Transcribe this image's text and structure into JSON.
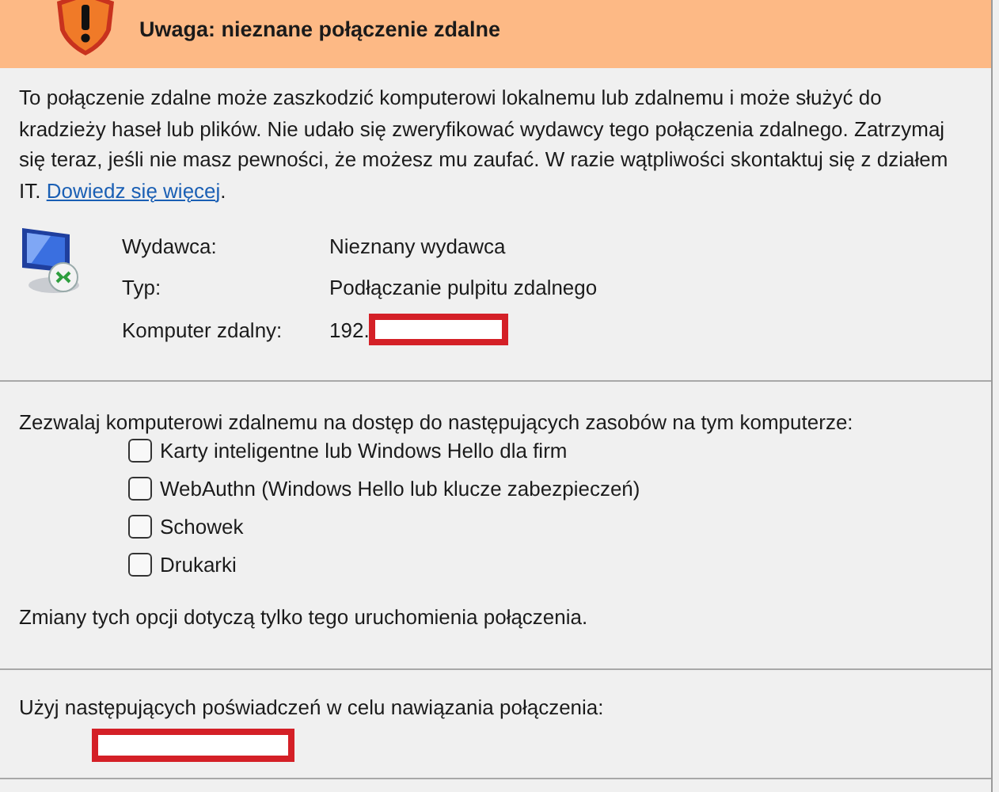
{
  "header": {
    "title": "Uwaga: nieznane połączenie zdalne"
  },
  "description": {
    "text": "To połączenie zdalne może zaszkodzić komputerowi lokalnemu lub zdalnemu i może służyć do kradzieży haseł lub plików. Nie udało się zweryfikować wydawcy tego połączenia zdalnego. Zatrzymaj się teraz, jeśli nie masz pewności, że możesz mu zaufać. W razie wątpliwości skontaktuj się z działem IT.",
    "link": "Dowiedz się więcej",
    "after": "."
  },
  "details": [
    {
      "label": "Wydawca:",
      "value": "Nieznany wydawca"
    },
    {
      "label": "Typ:",
      "value": "Podłączanie pulpitu zdalnego"
    },
    {
      "label": "Komputer zdalny:",
      "value": "192.",
      "redacted": true
    }
  ],
  "resources": {
    "intro": "Zezwalaj komputerowi zdalnemu na dostęp do następujących zasobów na tym komputerze:",
    "options": [
      {
        "label": "Karty inteligentne lub Windows Hello dla firm",
        "checked": false
      },
      {
        "label": "WebAuthn (Windows Hello lub klucze zabezpieczeń)",
        "checked": false
      },
      {
        "label": "Schowek",
        "checked": false
      },
      {
        "label": "Drukarki",
        "checked": false
      }
    ],
    "note": "Zmiany tych opcji dotyczą tylko tego uruchomienia połączenia."
  },
  "credentials": {
    "text": "Użyj następujących poświadczeń w celu nawiązania połączenia:",
    "redacted": true
  }
}
